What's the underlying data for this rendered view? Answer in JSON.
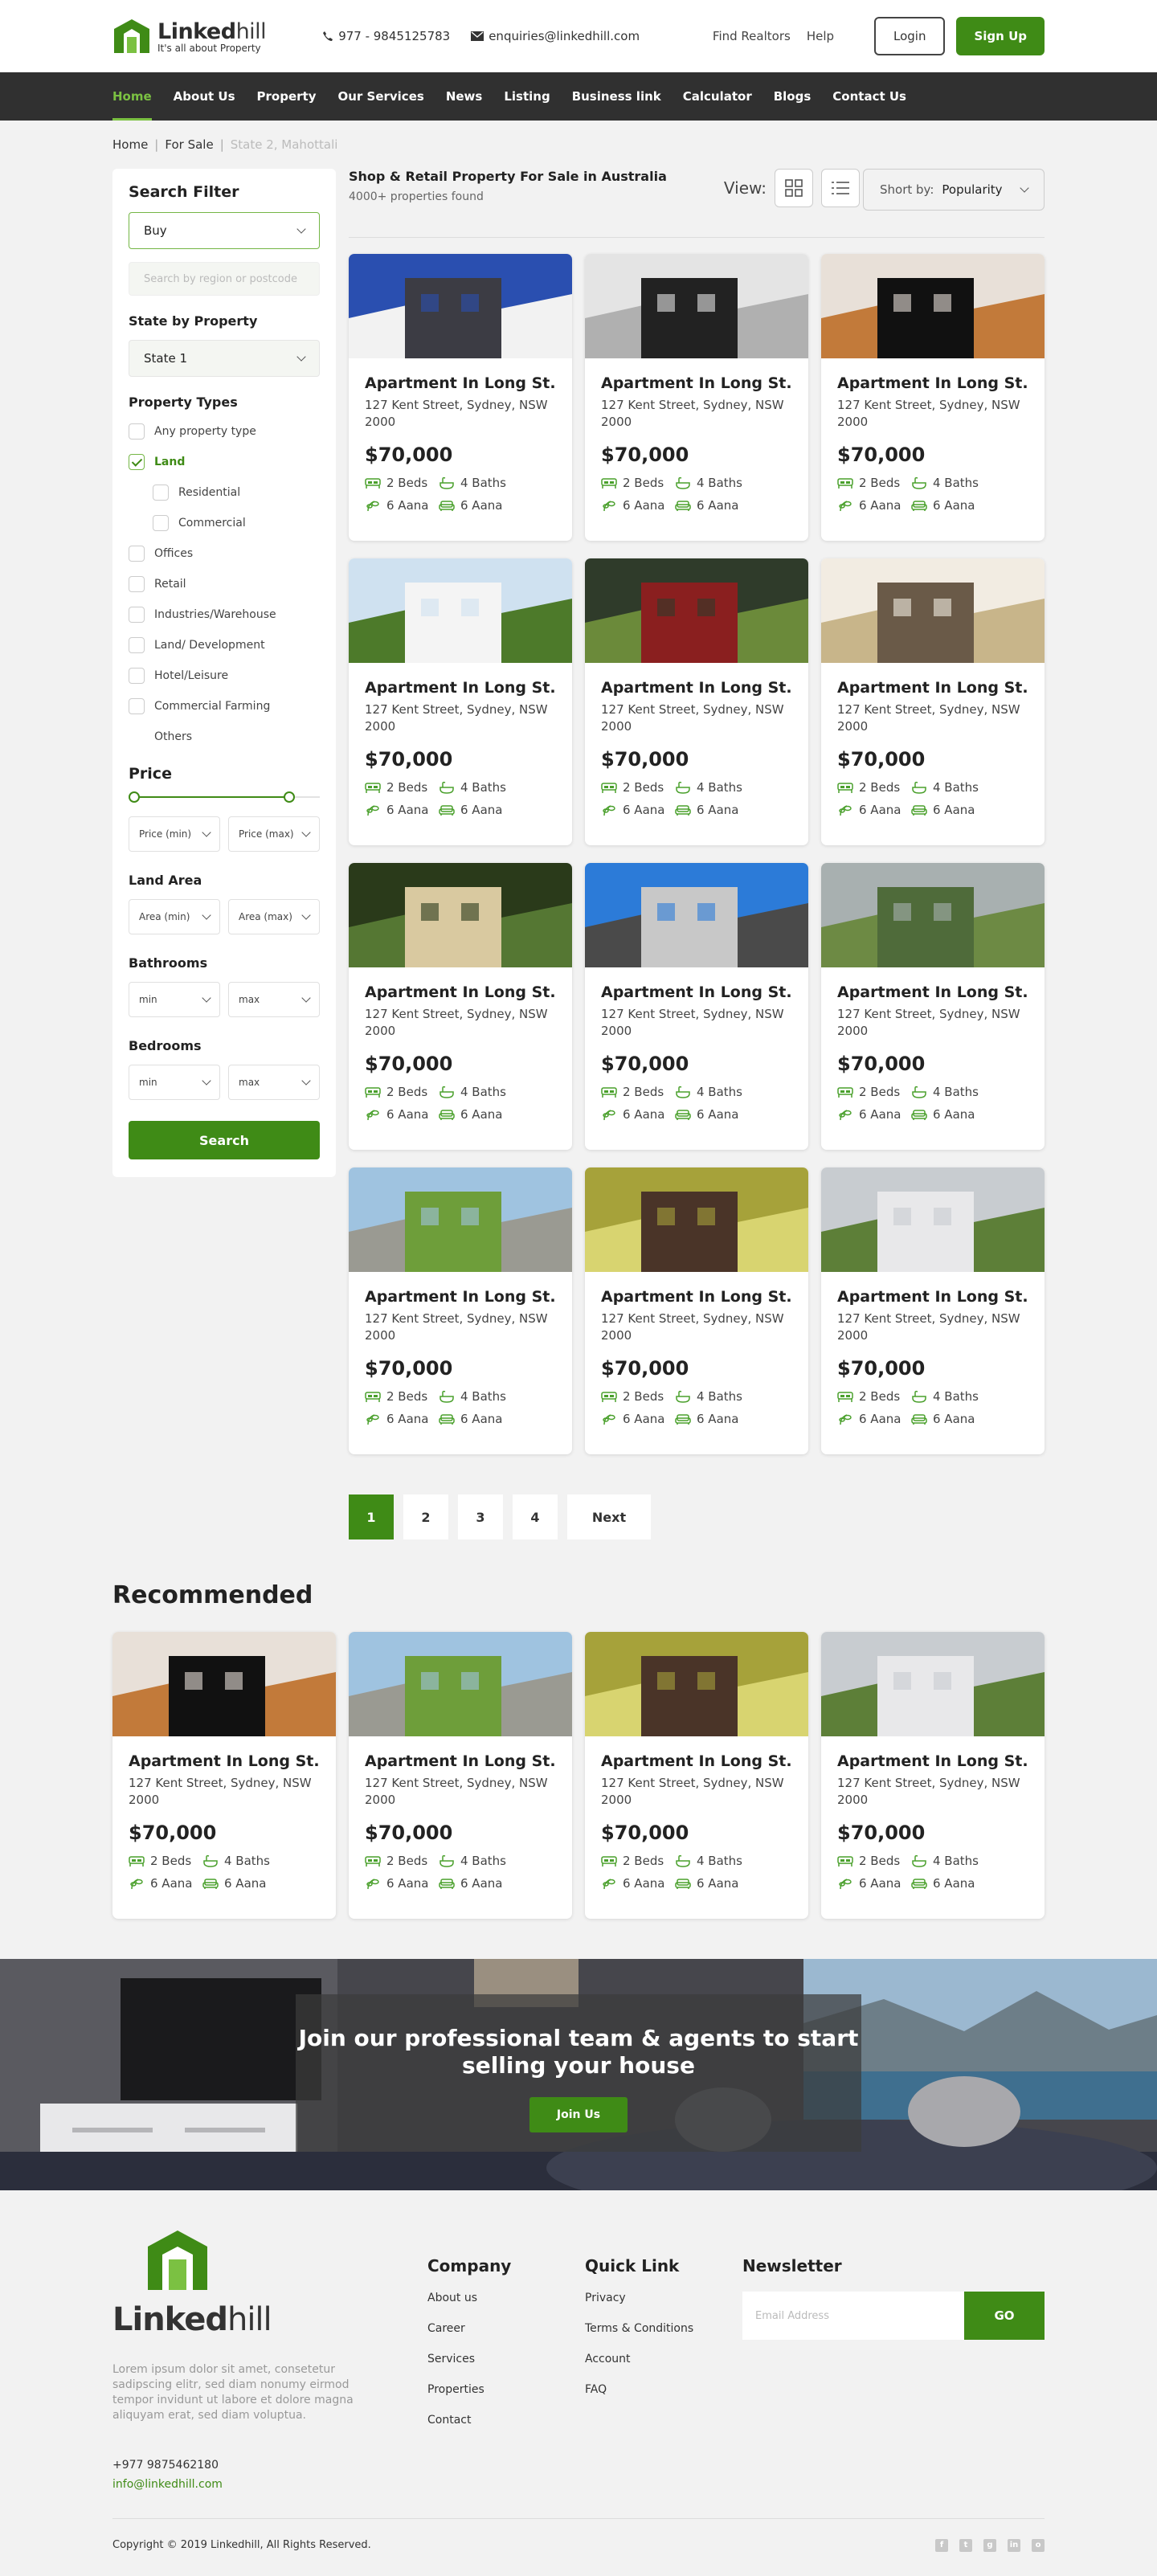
{
  "header": {
    "logo_name_bold": "Linked",
    "logo_name_light": "hill",
    "logo_tagline": "It's all about Property",
    "phone": "977 - 9845125783",
    "email": "enquiries@linkedhill.com",
    "find_realtors": "Find Realtors",
    "help": "Help",
    "login": "Login",
    "signup": "Sign Up"
  },
  "nav": [
    "Home",
    "About Us",
    "Property",
    "Our Services",
    "News",
    "Listing",
    "Business link",
    "Calculator",
    "Blogs",
    "Contact Us"
  ],
  "breadcrumb": [
    "Home",
    "For Sale",
    "State 2, Mahottali"
  ],
  "filter": {
    "title": "Search Filter",
    "type_value": "Buy",
    "region_placeholder": "Search by region or postcode",
    "state_heading": "State by Property",
    "state_value": "State 1",
    "types_heading": "Property Types",
    "types": [
      "Any property type",
      "Land",
      "Residential",
      "Commercial",
      "Offices",
      "Retail",
      "Industries/Warehouse",
      "Land/ Development",
      "Hotel/Leisure",
      "Commercial Farming",
      "Others"
    ],
    "price_heading": "Price",
    "price_range": [
      0,
      0.83
    ],
    "price_min": "Price (min)",
    "price_max": "Price (max)",
    "land_heading": "Land Area",
    "area_min": "Area (min)",
    "area_max": "Area (max)",
    "bath_heading": "Bathrooms",
    "bed_heading": "Bedrooms",
    "min": "min",
    "max": "max",
    "search": "Search"
  },
  "listing": {
    "title": "Shop & Retail Property For Sale in Australia",
    "count": "4000+ properties found",
    "view_label": "View:",
    "sort_label": "Short by:",
    "sort_value": "Popularity"
  },
  "card": {
    "title": "Apartment In Long St.",
    "addr": "127 Kent Street, Sydney, NSW 2000",
    "price": "$70,000",
    "beds": "2 Beds",
    "baths": "4 Baths",
    "aana1": "6 Aana",
    "aana2": "6 Aana"
  },
  "pagination": [
    "1",
    "2",
    "3",
    "4",
    "Next"
  ],
  "recommended_title": "Recommended",
  "banner": {
    "heading": "Join our professional team & agents to start selling your house",
    "button": "Join Us"
  },
  "footer": {
    "lorem": "Lorem ipsum dolor sit amet, consetetur sadipscing elitr, sed diam nonumy eirmod tempor invidunt ut labore et dolore magna aliquyam erat, sed diam voluptua.",
    "phone": "+977 9875462180",
    "mail": "info@linkedhill.com",
    "company_title": "Company",
    "company_links": [
      "About us",
      "Career",
      "Services",
      "Properties",
      "Contact"
    ],
    "quick_title": "Quick Link",
    "quick_links": [
      "Privacy",
      "Terms & Conditions",
      "Account",
      "FAQ"
    ],
    "news_title": "Newsletter",
    "email_placeholder": "Email Address",
    "go": "GO",
    "copyright": "Copyright © 2019 Linkedhill, All Rights Reserved.",
    "social_icons": [
      "facebook-icon",
      "twitter-icon",
      "google-plus-icon",
      "linkedin-icon",
      "instagram-icon"
    ]
  },
  "colors": {
    "brand_green": "#3f8b16",
    "light_green": "#7bc142",
    "navbar": "#303030"
  }
}
